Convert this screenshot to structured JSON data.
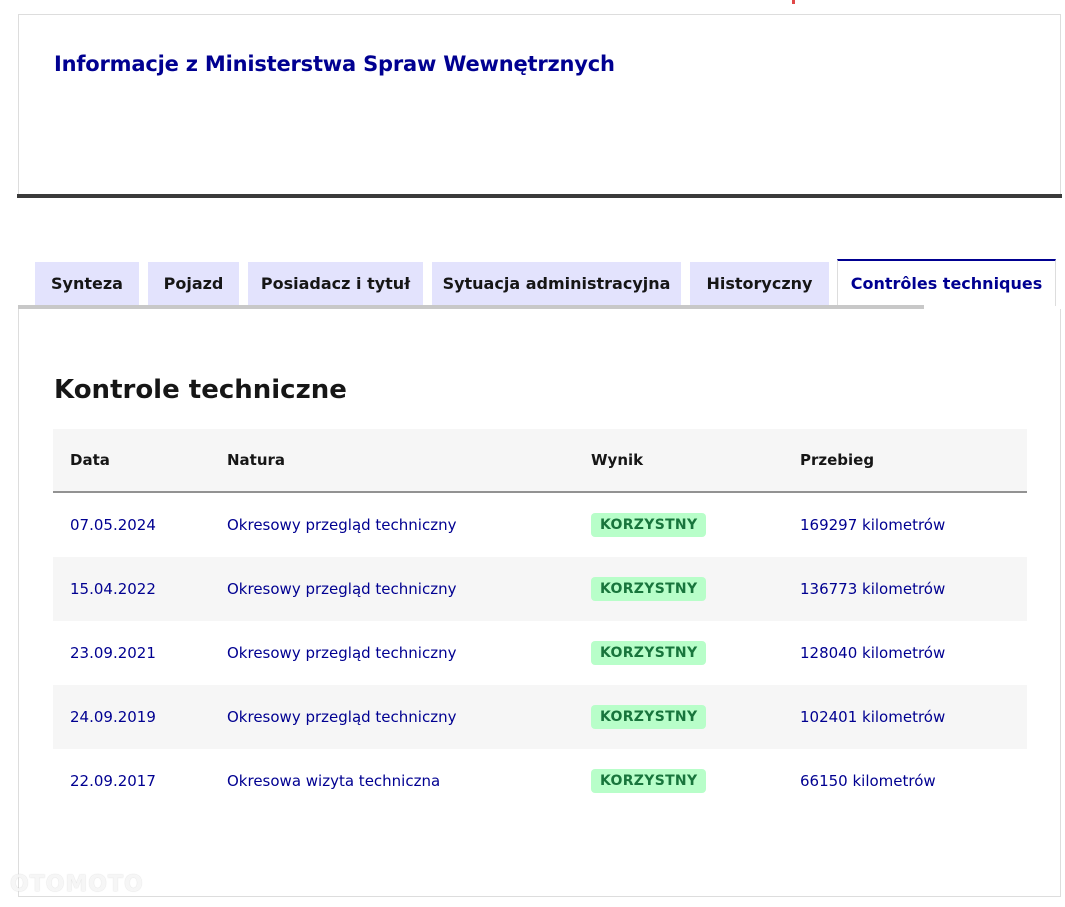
{
  "header": {
    "title": "Informacje z Ministerstwa Spraw Wewnętrznych"
  },
  "tabs": [
    {
      "label": "Synteza",
      "active": false
    },
    {
      "label": "Pojazd",
      "active": false
    },
    {
      "label": "Posiadacz i tytuł",
      "active": false
    },
    {
      "label": "Sytuacja administracyjna",
      "active": false
    },
    {
      "label": "Historyczny",
      "active": false
    },
    {
      "label": "Contrôles techniques",
      "active": true
    }
  ],
  "section": {
    "title": "Kontrole techniczne"
  },
  "table": {
    "columns": [
      "Data",
      "Natura",
      "Wynik",
      "Przebieg"
    ],
    "rows": [
      {
        "date": "07.05.2024",
        "nature": "Okresowy przegląd techniczny",
        "result": "KORZYSTNY",
        "mileage": "169297 kilometrów"
      },
      {
        "date": "15.04.2022",
        "nature": "Okresowy przegląd techniczny",
        "result": "KORZYSTNY",
        "mileage": "136773 kilometrów"
      },
      {
        "date": "23.09.2021",
        "nature": "Okresowy przegląd techniczny",
        "result": "KORZYSTNY",
        "mileage": "128040 kilometrów"
      },
      {
        "date": "24.09.2019",
        "nature": "Okresowy przegląd techniczny",
        "result": "KORZYSTNY",
        "mileage": "102401 kilometrów"
      },
      {
        "date": "22.09.2017",
        "nature": "Okresowa wizyta techniczna",
        "result": "KORZYSTNY",
        "mileage": "66150 kilometrów"
      }
    ]
  },
  "colors": {
    "accent": "#000091",
    "tab_background": "#e3e3fd",
    "badge_background": "#b8fec9",
    "badge_text": "#18753c",
    "row_alt": "#f6f6f6"
  },
  "watermark": {
    "text": "OTOMOTO"
  }
}
